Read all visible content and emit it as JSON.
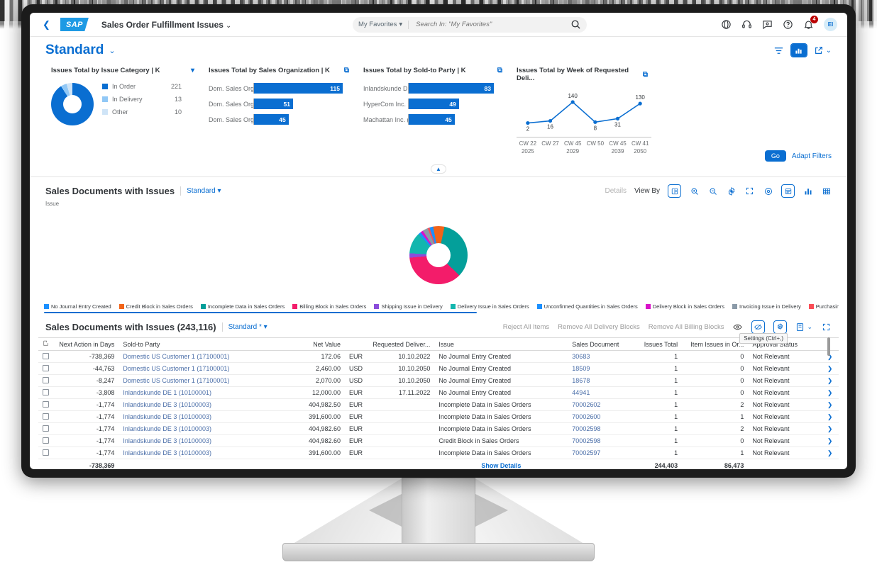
{
  "shell": {
    "back_icon": "chevron-left-icon",
    "logo_text": "SAP",
    "app_title": "Sales Order Fulfillment Issues",
    "app_title_chevron": "⌄",
    "search_scope": "My Favorites",
    "search_placeholder": "Search In: \"My Favorites\"",
    "search_value": "",
    "icons": [
      "globe-icon",
      "headset-icon",
      "feedback-icon",
      "help-icon",
      "bell-icon"
    ],
    "notification_count": "4",
    "avatar_initials": "EI"
  },
  "page": {
    "title": "Standard",
    "title_chevron": "⌄",
    "view_filter_icon": "filter-icon",
    "view_chart_icon": "chart-icon",
    "share_icon": "share-icon",
    "share_chevron": "⌄"
  },
  "filters": {
    "go_label": "Go",
    "adapt_label": "Adapt Filters",
    "collapse_icon": "chevron-up-icon"
  },
  "cards": [
    {
      "title": "Issues Total by Issue Category  | K",
      "action_icon": "chevron-down-icon",
      "type": "donut",
      "legend": [
        {
          "label": "In Order",
          "value": "221",
          "color": "#0a6ed1",
          "pct": 91.0
        },
        {
          "label": "In Delivery",
          "value": "13",
          "color": "#91c8f6",
          "pct": 4.5
        },
        {
          "label": "Other",
          "value": "10",
          "color": "#cfe4f7",
          "pct": 4.5
        }
      ]
    },
    {
      "title": "Issues Total by Sales Organization  | K",
      "action_icon": "open-in-new-icon",
      "type": "bar",
      "bars": [
        {
          "label": "Dom. Sales Org ...",
          "value": "115",
          "pct": 100
        },
        {
          "label": "Dom. Sales Org ...",
          "value": "51",
          "pct": 44
        },
        {
          "label": "Dom. Sales Org ...",
          "value": "45",
          "pct": 39
        }
      ]
    },
    {
      "title": "Issues Total by Sold-to Party  | K",
      "action_icon": "open-in-new-icon",
      "type": "bar",
      "bars": [
        {
          "label": "Inlandskunde D...",
          "value": "83",
          "pct": 100
        },
        {
          "label": "HyperCom Inc. (...",
          "value": "49",
          "pct": 59
        },
        {
          "label": "Machattan Inc. (...",
          "value": "45",
          "pct": 54
        }
      ]
    },
    {
      "title": "Issues Total by Week of Requested Deli...",
      "action_icon": "open-in-new-icon",
      "type": "line"
    }
  ],
  "chart_data": [
    {
      "type": "pie",
      "title": "Issues Total by Issue Category  | K",
      "categories": [
        "In Order",
        "In Delivery",
        "Other"
      ],
      "values": [
        221,
        13,
        10
      ],
      "colors": [
        "#0a6ed1",
        "#91c8f6",
        "#cfe4f7"
      ],
      "legend": "right"
    },
    {
      "type": "bar",
      "title": "Issues Total by Sales Organization  | K",
      "categories": [
        "Dom. Sales Org ...",
        "Dom. Sales Org ...",
        "Dom. Sales Org ..."
      ],
      "values": [
        115,
        51,
        45
      ],
      "xlabel": "",
      "ylabel": "",
      "xlim": [
        0,
        115
      ],
      "grid": false
    },
    {
      "type": "bar",
      "title": "Issues Total by Sold-to Party  | K",
      "categories": [
        "Inlandskunde D...",
        "HyperCom Inc. (...",
        "Machattan Inc. (..."
      ],
      "values": [
        83,
        49,
        45
      ],
      "xlabel": "",
      "ylabel": "",
      "xlim": [
        0,
        83
      ],
      "grid": false
    },
    {
      "type": "line",
      "title": "Issues Total by Week of Requested Deli...",
      "categories": [
        "CW 22",
        "CW 27",
        "CW 45",
        "CW 50",
        "CW 45",
        "CW 41"
      ],
      "sub_categories": [
        "2025",
        "",
        "2029",
        "",
        "2039",
        "2050"
      ],
      "values": [
        2,
        16,
        140,
        8,
        31,
        130
      ],
      "color": "#0a6ed1",
      "grid": false,
      "ylim": [
        0,
        140
      ]
    },
    {
      "type": "pie",
      "title": "Sales Documents with Issues",
      "axis_label": "Issue",
      "categories": [
        "No Journal Entry Created",
        "Credit Block in Sales Orders",
        "Incomplete Data in Sales Orders",
        "Billing Block in Sales Orders",
        "Shipping Issue in Delivery",
        "Delivery Issue in Sales Orders",
        "Unconfirmed Quantities in Sales Orders",
        "Delivery Block in Sales Orders",
        "Invoicing Issue in Delivery",
        "Purchasing Issu"
      ],
      "colors": [
        "#1b90ff",
        "#f26419",
        "#049f9a",
        "#f31c6a",
        "#8b4ddb",
        "#13b6ae",
        "#1b90ff",
        "#d912c9",
        "#8b9aa8",
        "#fa4d56"
      ],
      "values": [
        1.8,
        5.5,
        30.0,
        32.0,
        2.2,
        10.5,
        1.3,
        1.3,
        2.6,
        1.0
      ],
      "legend": "bottom"
    }
  ],
  "chart_block": {
    "title": "Sales Documents with Issues",
    "variant": "Standard",
    "variant_chevron": "⌄",
    "axis_label": "Issue",
    "details_label": "Details",
    "viewby_label": "View By",
    "tools": [
      "legend-icon",
      "zoom-in-icon",
      "zoom-out-icon",
      "settings-icon",
      "fullscreen-icon",
      "drilldown-icon",
      "chart-type-icon",
      "bar-chart-icon",
      "table-icon"
    ],
    "legend": [
      {
        "label": "No Journal Entry Created",
        "color": "#1b90ff"
      },
      {
        "label": "Credit Block in Sales Orders",
        "color": "#f26419"
      },
      {
        "label": "Incomplete Data in Sales Orders",
        "color": "#049f9a"
      },
      {
        "label": "Billing Block in Sales Orders",
        "color": "#f31c6a"
      },
      {
        "label": "Shipping Issue in Delivery",
        "color": "#8b4ddb"
      },
      {
        "label": "Delivery Issue in Sales Orders",
        "color": "#13b6ae"
      },
      {
        "label": "Unconfirmed Quantities in Sales Orders",
        "color": "#1b90ff"
      },
      {
        "label": "Delivery Block in Sales Orders",
        "color": "#d912c9"
      },
      {
        "label": "Invoicing Issue in Delivery",
        "color": "#8b9aa8"
      },
      {
        "label": "Purchasing Issu",
        "color": "#fa4d56"
      }
    ]
  },
  "table": {
    "title": "Sales Documents with Issues (243,116)",
    "variant": "Standard *",
    "variant_chevron": "⌄",
    "actions": [
      "Reject All Items",
      "Remove All Delivery Blocks",
      "Remove All Billing Blocks"
    ],
    "icons": [
      "eye-icon",
      "eye-off-icon",
      "settings-gear-icon",
      "export-icon",
      "fullscreen-icon"
    ],
    "export_chevron": "⌄",
    "tooltip": "Settings (Ctrl+,)",
    "columns": [
      "Next Action in Days",
      "Sold-to Party",
      "Net Value",
      "",
      "Requested Deliver...",
      "Issue",
      "Sales Document",
      "Issues Total",
      "Item Issues in Or...",
      "Approval Status"
    ],
    "rows": [
      {
        "days": "-738,369",
        "party": "Domestic US Customer 1 (17100001)",
        "net": "172.06",
        "cur": "EUR",
        "date": "10.10.2022",
        "issue": "No Journal Entry Created",
        "doc": "30683",
        "total": "1",
        "items": "0",
        "approval": "Not Relevant"
      },
      {
        "days": "-44,763",
        "party": "Domestic US Customer 1 (17100001)",
        "net": "2,460.00",
        "cur": "USD",
        "date": "10.10.2050",
        "issue": "No Journal Entry Created",
        "doc": "18509",
        "total": "1",
        "items": "0",
        "approval": "Not Relevant"
      },
      {
        "days": "-8,247",
        "party": "Domestic US Customer 1 (17100001)",
        "net": "2,070.00",
        "cur": "USD",
        "date": "10.10.2050",
        "issue": "No Journal Entry Created",
        "doc": "18678",
        "total": "1",
        "items": "0",
        "approval": "Not Relevant"
      },
      {
        "days": "-3,808",
        "party": "Inlandskunde DE 1 (10100001)",
        "net": "12,000.00",
        "cur": "EUR",
        "date": "17.11.2022",
        "issue": "No Journal Entry Created",
        "doc": "44941",
        "total": "1",
        "items": "0",
        "approval": "Not Relevant"
      },
      {
        "days": "-1,774",
        "party": "Inlandskunde DE 3 (10100003)",
        "net": "404,982.50",
        "cur": "EUR",
        "date": "",
        "issue": "Incomplete Data in Sales Orders",
        "doc": "70002602",
        "total": "1",
        "items": "2",
        "approval": "Not Relevant"
      },
      {
        "days": "-1,774",
        "party": "Inlandskunde DE 3 (10100003)",
        "net": "391,600.00",
        "cur": "EUR",
        "date": "",
        "issue": "Incomplete Data in Sales Orders",
        "doc": "70002600",
        "total": "1",
        "items": "1",
        "approval": "Not Relevant"
      },
      {
        "days": "-1,774",
        "party": "Inlandskunde DE 3 (10100003)",
        "net": "404,982.60",
        "cur": "EUR",
        "date": "",
        "issue": "Incomplete Data in Sales Orders",
        "doc": "70002598",
        "total": "1",
        "items": "2",
        "approval": "Not Relevant"
      },
      {
        "days": "-1,774",
        "party": "Inlandskunde DE 3 (10100003)",
        "net": "404,982.60",
        "cur": "EUR",
        "date": "",
        "issue": "Credit Block in Sales Orders",
        "doc": "70002598",
        "total": "1",
        "items": "0",
        "approval": "Not Relevant"
      },
      {
        "days": "-1,774",
        "party": "Inlandskunde DE 3 (10100003)",
        "net": "391,600.00",
        "cur": "EUR",
        "date": "",
        "issue": "Incomplete Data in Sales Orders",
        "doc": "70002597",
        "total": "1",
        "items": "1",
        "approval": "Not Relevant"
      }
    ],
    "footer": {
      "days_total": "-738,369",
      "show_details": "Show Details",
      "issues_total": "244,403",
      "item_issues_total": "86,473"
    }
  }
}
